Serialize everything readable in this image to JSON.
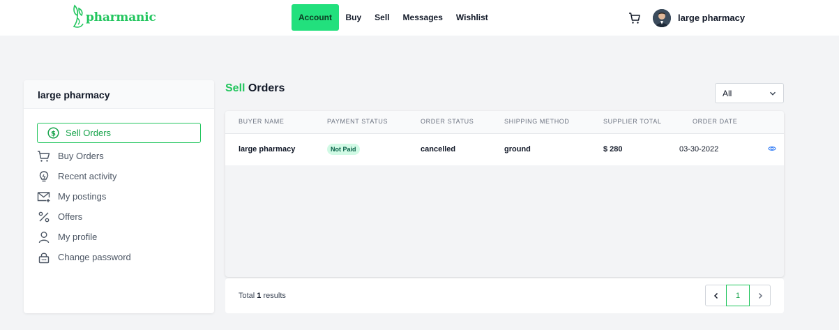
{
  "brand": {
    "name": "pharmanic",
    "accent_color": "#22c55e"
  },
  "nav": {
    "items": [
      {
        "label": "Account",
        "active": true
      },
      {
        "label": "Buy"
      },
      {
        "label": "Sell"
      },
      {
        "label": "Messages"
      },
      {
        "label": "Wishlist"
      }
    ],
    "cart_icon": "cart-icon",
    "user_name": "large pharmacy"
  },
  "sidebar": {
    "title": "large pharmacy",
    "items": [
      {
        "label": "Sell Orders",
        "icon": "dollar-circle-icon",
        "active": true
      },
      {
        "label": "Buy Orders",
        "icon": "cart-icon"
      },
      {
        "label": "Recent activity",
        "icon": "lightbulb-icon"
      },
      {
        "label": "My postings",
        "icon": "mail-icon"
      },
      {
        "label": "Offers",
        "icon": "percent-icon"
      },
      {
        "label": "My profile",
        "icon": "user-icon"
      },
      {
        "label": "Change password",
        "icon": "lock-icon"
      }
    ]
  },
  "main": {
    "title_accent": "Sell",
    "title_rest": " Orders",
    "filter": {
      "selected": "All"
    },
    "table": {
      "headers": [
        "Buyer Name",
        "Payment Status",
        "Order Status",
        "Shipping Method",
        "Supplier Total",
        "Order Date"
      ],
      "rows": [
        {
          "buyer": "large pharmacy",
          "payment_status": "Not Paid",
          "order_status": "cancelled",
          "shipping": "ground",
          "total": "$ 280",
          "date": "03-30-2022"
        }
      ]
    },
    "footer": {
      "total_prefix": "Total ",
      "total_count": "1",
      "total_suffix": " results",
      "current_page": "1"
    }
  }
}
